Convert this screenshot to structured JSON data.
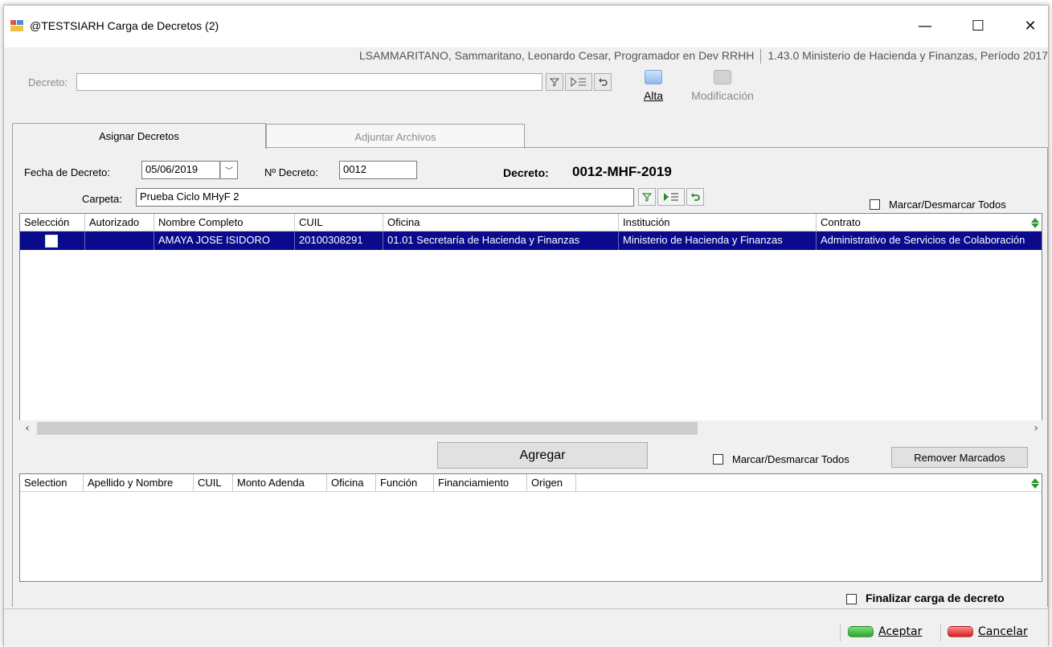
{
  "window": {
    "title": "@TESTSIARH Carga de Decretos (2)",
    "minimize_glyph": "—",
    "maximize_glyph": "☐",
    "close_glyph": "✕"
  },
  "user_info": {
    "user": "LSAMMARITANO, Sammaritano, Leonardo Cesar, Programador en Dev RRHH",
    "version": "1.43.0 Ministerio de Hacienda y Finanzas, Período 2017"
  },
  "decreto_search": {
    "label": "Decreto:",
    "value": ""
  },
  "toolbar": {
    "alta_label": "Alta",
    "modificacion_label": "Modificación"
  },
  "tabs": [
    {
      "label": "Asignar Decretos",
      "active": true
    },
    {
      "label": "Adjuntar Archivos",
      "active": false
    }
  ],
  "form": {
    "fecha_label": "Fecha de Decreto:",
    "fecha_value": "05/06/2019",
    "nro_label": "Nº Decreto:",
    "nro_value": "0012",
    "decreto_label": "Decreto:",
    "decreto_value": "0012-MHF-2019",
    "carpeta_label": "Carpeta:",
    "carpeta_value": "Prueba Ciclo MHyF 2",
    "marcar_todos_label": "Marcar/Desmarcar Todos"
  },
  "top_grid": {
    "columns": [
      "Selección",
      "Autorizado",
      "Nombre Completo",
      "CUIL",
      "Oficina",
      "Institución",
      "Contrato"
    ],
    "rows": [
      {
        "seleccion": false,
        "autorizado": "",
        "nombre": "AMAYA JOSE ISIDORO",
        "cuil": "20100308291",
        "oficina": "01.01 Secretaría de Hacienda y Finanzas",
        "institucion": "Ministerio de Hacienda y Finanzas",
        "contrato": "Administrativo de Servicios de Colaboración"
      }
    ]
  },
  "scroll": {
    "left_glyph": "‹",
    "right_glyph": "›"
  },
  "actions": {
    "agregar_label": "Agregar",
    "marcar_todos_label": "Marcar/Desmarcar Todos",
    "remover_label": "Remover Marcados"
  },
  "bottom_grid": {
    "columns": [
      "Selection",
      "Apellido y Nombre",
      "CUIL",
      "Monto Adenda",
      "Oficina",
      "Función",
      "Financiamiento",
      "Origen"
    ]
  },
  "finalizar_label": "Finalizar carga de decreto",
  "footer": {
    "aceptar_label": "Aceptar",
    "cancelar_label": "Cancelar"
  },
  "colors": {
    "selection_row": "#0a0a8c",
    "aceptar": "#3cb043",
    "cancelar": "#e53935"
  }
}
